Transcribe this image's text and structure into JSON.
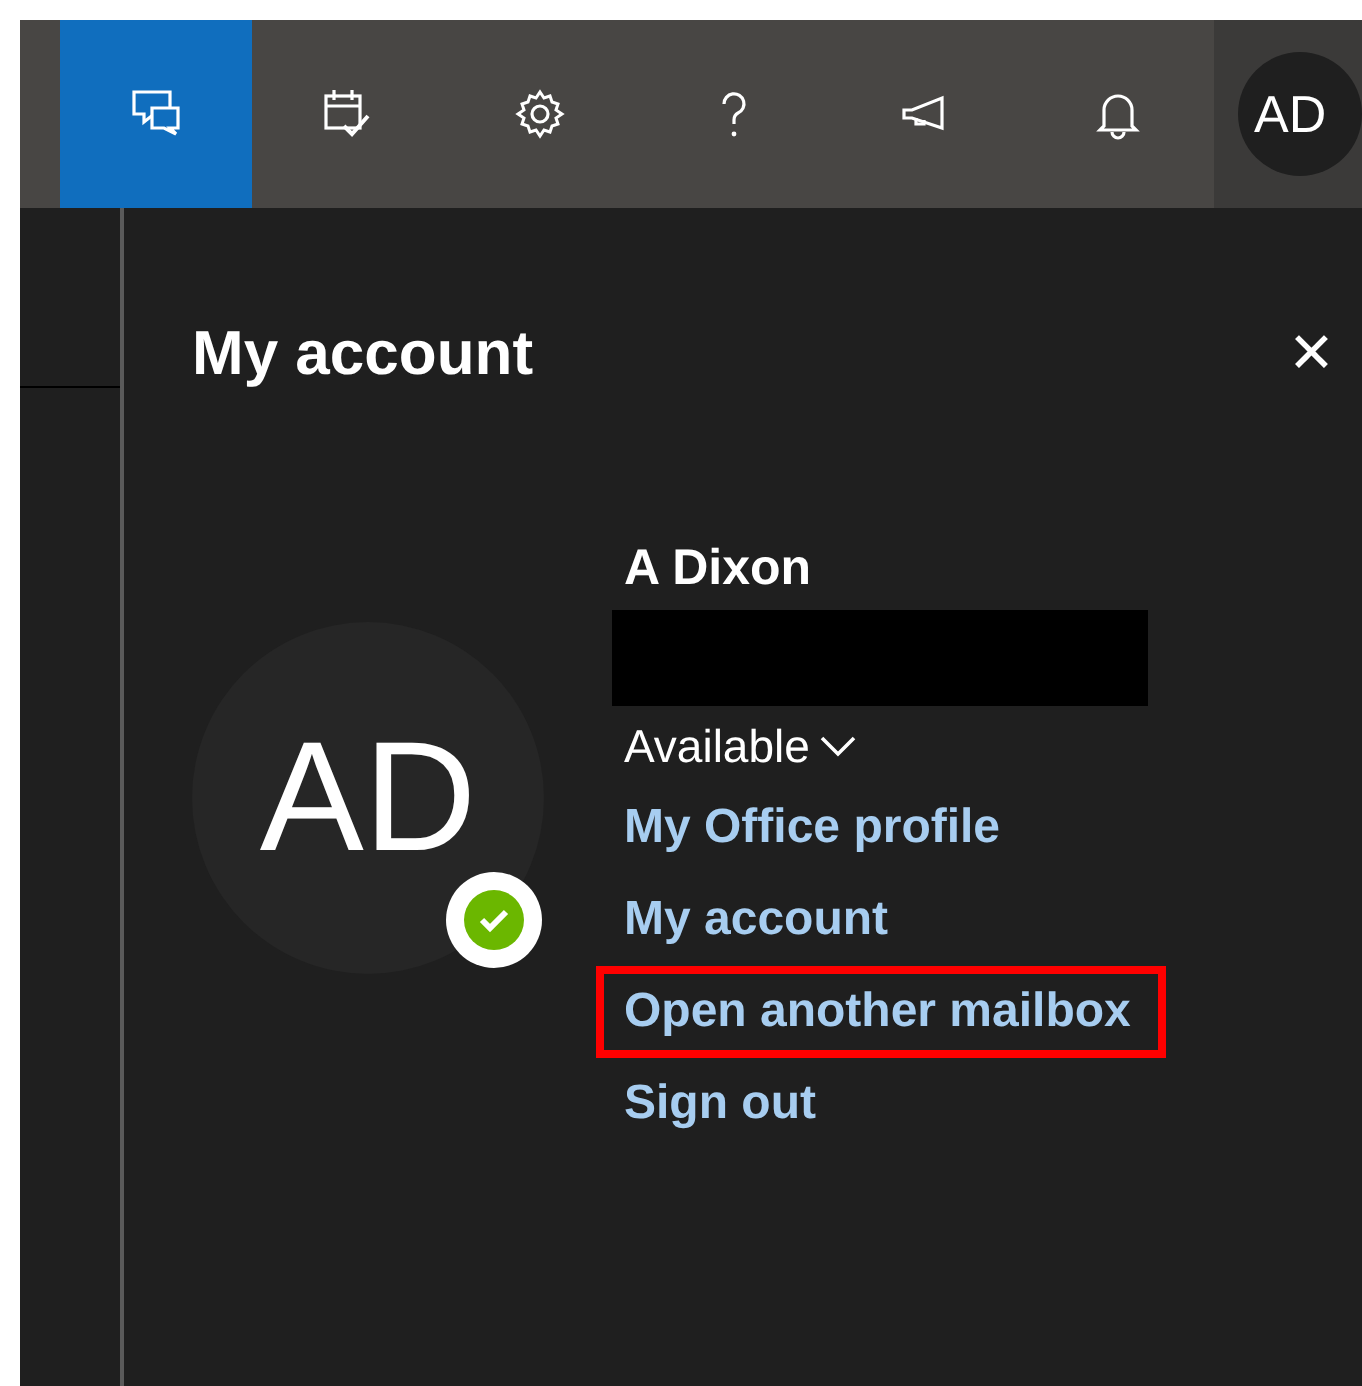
{
  "top_bar": {
    "buttons": [
      {
        "kind": "chat",
        "selected": true
      },
      {
        "kind": "calendar-check",
        "selected": false
      },
      {
        "kind": "settings",
        "selected": false
      },
      {
        "kind": "help",
        "selected": false
      },
      {
        "kind": "megaphone",
        "selected": false
      },
      {
        "kind": "bell",
        "selected": false
      }
    ],
    "avatar": {
      "initials": "AD"
    }
  },
  "panel": {
    "title": "My account",
    "close": "✕",
    "avatar": {
      "initials": "AD"
    },
    "name": "A Dixon",
    "status": "Available",
    "links": [
      {
        "label": "My Office profile",
        "highlighted": false
      },
      {
        "label": "My account",
        "highlighted": false
      },
      {
        "label": "Open another mailbox",
        "highlighted": true
      },
      {
        "label": "Sign out",
        "highlighted": false
      }
    ]
  }
}
